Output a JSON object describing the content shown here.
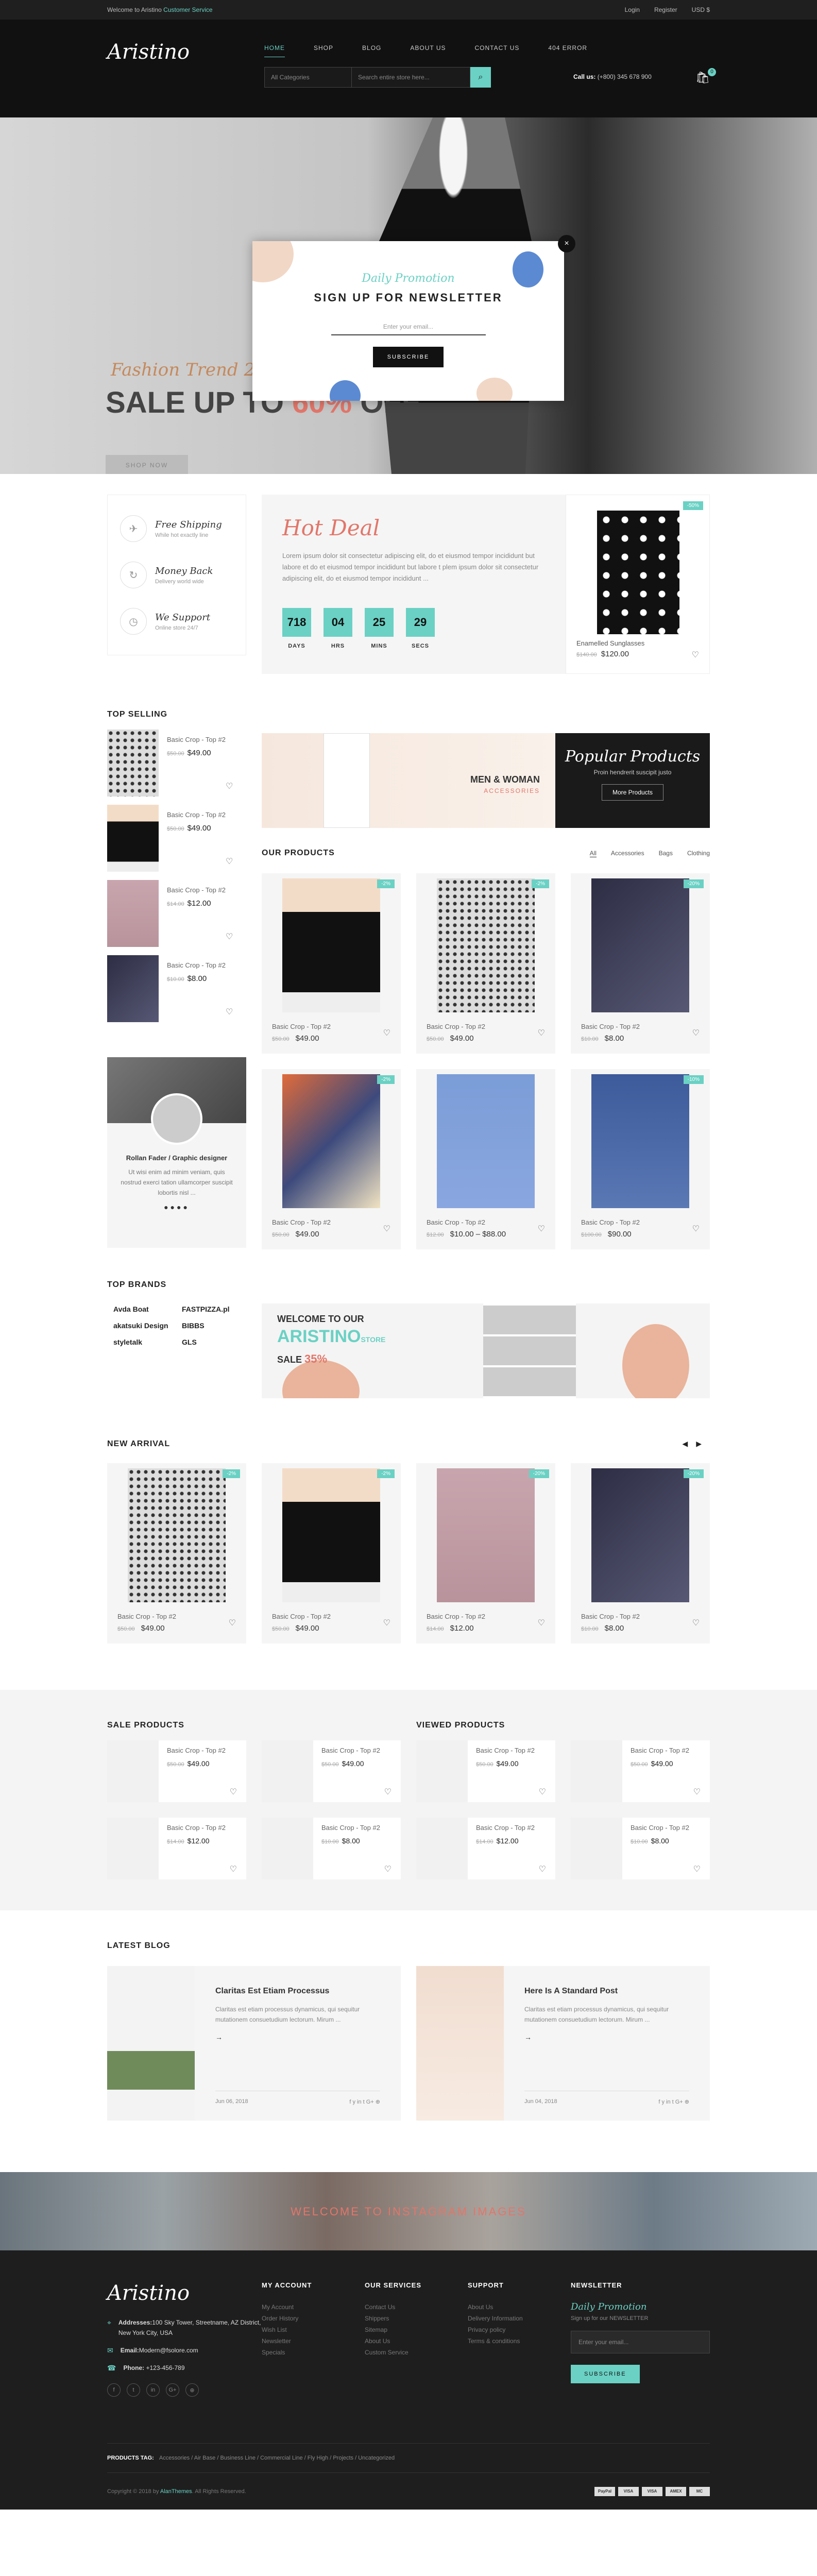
{
  "topbar": {
    "welcome": "Welcome to Aristino",
    "welcome_acc": "Customer Service",
    "login": "Login",
    "register": "Register",
    "currency": "USD $"
  },
  "header": {
    "logo": "Aristino",
    "nav": [
      "Home",
      "Shop",
      "Blog",
      "About Us",
      "Contact Us",
      "404 Error"
    ],
    "search_cat": "All Categories",
    "search_placeholder": "Search entire store here...",
    "call_label": "Call us:",
    "call_number": "(+800) 345 678 900",
    "cart_count": "0"
  },
  "hero": {
    "trend": "Fashion Trend 2018",
    "sale_a": "SALE UP TO ",
    "sale_pct": "60%",
    "sale_b": " OFF",
    "shop": "SHOP NOW"
  },
  "popup": {
    "promo": "Daily Promotion",
    "title": "SIGN UP FOR NEWSLETTER",
    "placeholder": "Enter your email...",
    "button": "SUBSCRIBE",
    "close": "×"
  },
  "policy": [
    {
      "t": "Free Shipping",
      "s": "While hot exactly line"
    },
    {
      "t": "Money Back",
      "s": "Delivery world wide"
    },
    {
      "t": "We Support",
      "s": "Online store 24/7"
    }
  ],
  "hotdeal": {
    "hot": "Hot",
    "deal": " Deal",
    "desc": "Lorem ipsum dolor sit consectetur adipiscing elit, do et eiusmod tempor incididunt but labore et do et eiusmod tempor incididunt but labore t plem ipsum dolor sit consectetur adipiscing elit, do et eiusmod tempor incididunt ...",
    "countdown": [
      {
        "n": "718",
        "l": "DAYS"
      },
      {
        "n": "04",
        "l": "HRS"
      },
      {
        "n": "25",
        "l": "MINS"
      },
      {
        "n": "29",
        "l": "SECS"
      }
    ],
    "product": {
      "badge": "-50%",
      "name": "Enamelled Sunglasses",
      "old": "$140.00",
      "price": "$120.00"
    }
  },
  "top_selling": {
    "title": "TOP SELLING",
    "items": [
      {
        "name": "Basic Crop - Top #2",
        "old": "$50.00",
        "price": "$49.00"
      },
      {
        "name": "Basic Crop - Top #2",
        "old": "$50.00",
        "price": "$49.00"
      },
      {
        "name": "Basic Crop - Top #2",
        "old": "$14.00",
        "price": "$12.00"
      },
      {
        "name": "Basic Crop - Top #2",
        "old": "$10.00",
        "price": "$8.00"
      }
    ]
  },
  "banners": {
    "men_women": "MEN & WOMAN",
    "accessories": "ACCESSORIES",
    "popular": "Popular Products",
    "popular_sub": "Proin hendrerit suscipit justo",
    "more": "More Products"
  },
  "our_products": {
    "title": "OUR PRODUCTS",
    "tabs": [
      "All",
      "Accessories",
      "Bags",
      "Clothing"
    ],
    "items": [
      {
        "badge": "-2%",
        "name": "Basic Crop - Top #2",
        "old": "$50.00",
        "price": "$49.00"
      },
      {
        "badge": "-2%",
        "name": "Basic Crop - Top #2",
        "old": "$50.00",
        "price": "$49.00"
      },
      {
        "badge": "-20%",
        "name": "Basic Crop - Top #2",
        "old": "$10.00",
        "price": "$8.00"
      },
      {
        "badge": "-2%",
        "name": "Basic Crop - Top #2",
        "old": "$50.00",
        "price": "$49.00"
      },
      {
        "badge": "",
        "name": "Basic Crop - Top #2",
        "old": "$12.00",
        "price": "$10.00 – $88.00"
      },
      {
        "badge": "-10%",
        "name": "Basic Crop - Top #2",
        "old": "$100.00",
        "price": "$90.00"
      }
    ]
  },
  "testimonial": {
    "name": "Rollan Fader / Graphic designer",
    "text": "Ut wisi enim ad minim veniam, quis nostrud exerci tation ullamcorper suscipit lobortis nisl ...",
    "dots": "●●●●"
  },
  "brands": {
    "title": "TOP BRANDS",
    "items": [
      "Avda Boat",
      "FASTPIZZA.pl",
      "akatsuki Design",
      "BIBBS",
      "styletalk",
      "GLS"
    ]
  },
  "welcome": {
    "t1": "WELCOME TO OUR",
    "t2": "ARISTINO",
    "t2s": "STORE",
    "t3": "SALE",
    "t3p": "35%"
  },
  "new_arrival": {
    "title": "NEW ARRIVAL",
    "prev": "◀",
    "next": "▶",
    "items": [
      {
        "badge": "-2%",
        "name": "Basic Crop - Top #2",
        "old": "$50.00",
        "price": "$49.00"
      },
      {
        "badge": "-2%",
        "name": "Basic Crop - Top #2",
        "old": "$50.00",
        "price": "$49.00"
      },
      {
        "badge": "-20%",
        "name": "Basic Crop - Top #2",
        "old": "$14.00",
        "price": "$12.00"
      },
      {
        "badge": "-20%",
        "name": "Basic Crop - Top #2",
        "old": "$10.00",
        "price": "$8.00"
      }
    ]
  },
  "sale_products": {
    "title": "SALE PRODUCTS",
    "items": [
      {
        "name": "Basic Crop - Top #2",
        "old": "$50.00",
        "price": "$49.00"
      },
      {
        "name": "Basic Crop - Top #2",
        "old": "$50.00",
        "price": "$49.00"
      },
      {
        "name": "Basic Crop - Top #2",
        "old": "$14.00",
        "price": "$12.00"
      },
      {
        "name": "Basic Crop - Top #2",
        "old": "$10.00",
        "price": "$8.00"
      }
    ]
  },
  "viewed_products": {
    "title": "VIEWED PRODUCTS",
    "items": [
      {
        "name": "Basic Crop - Top #2",
        "old": "$50.00",
        "price": "$49.00"
      },
      {
        "name": "Basic Crop - Top #2",
        "old": "$50.00",
        "price": "$49.00"
      },
      {
        "name": "Basic Crop - Top #2",
        "old": "$14.00",
        "price": "$12.00"
      },
      {
        "name": "Basic Crop - Top #2",
        "old": "$10.00",
        "price": "$8.00"
      }
    ]
  },
  "blog": {
    "title": "LATEST BLOG",
    "posts": [
      {
        "title": "Claritas Est Etiam Processus",
        "excerpt": "Claritas est etiam processus dynamicus, qui sequitur mutationem consuetudium lectorum. Mirum ...",
        "more": "→",
        "date": "Jun 06, 2018",
        "share": "f  y  in  t  G+  ⊕"
      },
      {
        "title": "Here Is A Standard Post",
        "excerpt": "Claritas est etiam processus dynamicus, qui sequitur mutationem consuetudium lectorum. Mirum ...",
        "more": "→",
        "date": "Jun 04, 2018",
        "share": "f  y  in  t  G+  ⊕"
      }
    ]
  },
  "instagram": {
    "title": "WELCOME TO INSTAGRAM IMAGES"
  },
  "footer": {
    "logo": "Aristino",
    "address_label": "Addresses:",
    "address": "100 Sky Tower, Streetname, AZ District, New York City, USA",
    "email_label": "Email:",
    "email": "Modern@fsolore.com",
    "phone_label": "Phone:",
    "phone": "+123-456-789",
    "socials": [
      "f",
      "t",
      "in",
      "G+",
      "⊕"
    ],
    "my_account": {
      "title": "MY ACCOUNT",
      "items": [
        "My Account",
        "Order History",
        "Wish List",
        "Newsletter",
        "Specials"
      ]
    },
    "services": {
      "title": "OUR SERVICES",
      "items": [
        "Contact Us",
        "Shippers",
        "Sitemap",
        "About Us",
        "Custom Service"
      ]
    },
    "support": {
      "title": "SUPPORT",
      "items": [
        "About Us",
        "Delivery Information",
        "Privacy policy",
        "Terms & conditions"
      ]
    },
    "newsletter": {
      "title": "NEWSLETTER",
      "promo": "Daily Promotion",
      "sub": "Sign up for our NEWSLETTER",
      "placeholder": "Enter your email...",
      "button": "SUBSCRIBE"
    },
    "tags_label": "PRODUCTS TAG:",
    "tags": "Accessories  /  Air Base  /  Business Line  /  Commercial Line  /  Fly High  /  Projects  /  Uncategorized",
    "copyright": "Copyright © 2018 by ",
    "copyright_acc": "AlanThemes",
    "copyright_end": ". All Rights Reserved.",
    "payments": [
      "PayPal",
      "VISA",
      "VISA",
      "AMEX",
      "MC"
    ]
  }
}
